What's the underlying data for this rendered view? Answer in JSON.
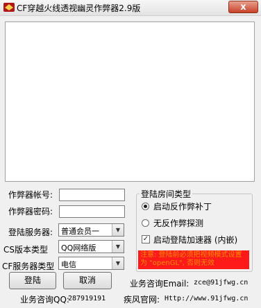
{
  "window": {
    "title": "CF穿越火线透视幽灵作弊器2.9版",
    "close_label": "x"
  },
  "form": {
    "account_label": "作弊器帐号:",
    "account_value": "",
    "password_label": "作弊器密码:",
    "password_value": "",
    "login_server_label": "登陆服务器:",
    "login_server_value": "普通会员一",
    "cs_version_label": "CS版本类型",
    "cs_version_value": "QQ网络版",
    "cf_server_label": "CF服务器类型",
    "cf_server_value": "电信"
  },
  "buttons": {
    "login": "登陆",
    "cancel": "取消"
  },
  "room_group": {
    "title": "登陆房间类型",
    "options": [
      {
        "label": "启动反作弊补丁",
        "checked": true
      },
      {
        "label": "无反作弊探测",
        "checked": false
      }
    ],
    "accelerator_label": "启动登陆加速器 (内嵌)",
    "accelerator_checked": true,
    "warning": "注意: 登陆前必须把视频模式设置为 \"openGL\", 否则无效"
  },
  "footer": {
    "email_label": "业务咨询Email:",
    "email_value": "zce@91jfwg.cn",
    "qq_label": "业务咨询QQ:",
    "qq_value": "287919191",
    "site_label": "疾风官网:",
    "site_value": "Http://www.91jfwg.cn"
  },
  "colors": {
    "warning_bg": "#ff1a1a",
    "warning_text": "#ff8c00",
    "close_button": "#c7412a"
  }
}
